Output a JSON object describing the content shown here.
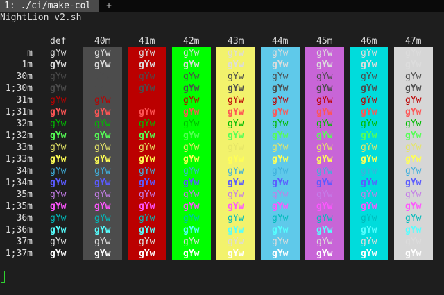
{
  "tab": {
    "label": "1: ./ci/make-col",
    "new_tab": "+"
  },
  "line0": "NightLion v2.sh",
  "sample": "gYw",
  "headers": [
    "def",
    "40m",
    "41m",
    "42m",
    "43m",
    "44m",
    "45m",
    "46m",
    "47m"
  ],
  "rows": [
    "m",
    "1m",
    "30m",
    "1;30m",
    "31m",
    "1;31m",
    "32m",
    "1;32m",
    "33m",
    "1;33m",
    "34m",
    "1;34m",
    "35m",
    "1;35m",
    "36m",
    "1;36m",
    "37m",
    "1;37m"
  ],
  "bg_colors": [
    "#4c4c4c",
    "#bb0000",
    "#00ff00",
    "#f2f26c",
    "#5fc9ea",
    "#c865d7",
    "#00dcdc",
    "#d6d6d6"
  ],
  "fg_colors": {
    "normal": [
      "#dcdcdc",
      "#dcdcdc",
      "#4c4c4c",
      "#4c4c4c",
      "#bb0000",
      "#ff5555",
      "#00bb00",
      "#55ff55",
      "#e5e567",
      "#ffff55",
      "#3fb0dc",
      "#5b5bff",
      "#c47de8",
      "#ff55ff",
      "#00bbbb",
      "#55ffff",
      "#dcdcdc",
      "#ffffff"
    ]
  }
}
